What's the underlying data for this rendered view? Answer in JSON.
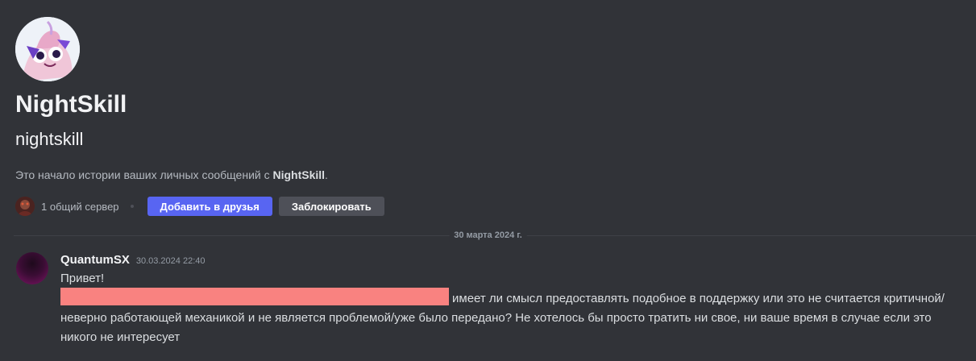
{
  "profile": {
    "display_name": "NightSkill",
    "username": "nightskill",
    "intro_prefix": "Это начало истории ваших личных сообщений с ",
    "intro_name": "NightSkill",
    "intro_suffix": "."
  },
  "actions": {
    "mutual_servers": "1 общий сервер",
    "add_friend_label": "Добавить в друзья",
    "block_label": "Заблокировать"
  },
  "date_divider": "30 марта 2024 г.",
  "message": {
    "author": "QuantumSX",
    "timestamp": "30.03.2024 22:40",
    "greeting": "Привет!",
    "line1_rest": "имеет ли смысл предоставлять подобное в поддержку или это не считается критичной/",
    "line2": "неверно работающей механикой и не является проблемой/уже было передано? Не хотелось бы просто тратить ни свое, ни ваше время в случае если это",
    "line3": "никого не интересует"
  },
  "colors": {
    "background": "#313338",
    "primary_button": "#5865f2",
    "secondary_button": "#4e5058",
    "redaction": "#f98280"
  },
  "icons": {
    "profile_avatar": "user-avatar-icon",
    "mutual_server_avatar": "server-avatar-icon",
    "message_avatar": "author-avatar-icon"
  }
}
